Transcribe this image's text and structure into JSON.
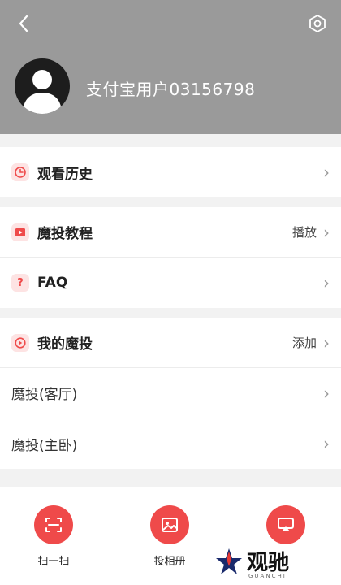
{
  "header": {
    "username": "支付宝用户03156798",
    "back_icon": "chevron-left-icon",
    "settings_icon": "settings-hex-icon"
  },
  "groups": {
    "history": {
      "label": "观看历史",
      "icon": "clock-icon"
    },
    "tutorial": {
      "label": "魔投教程",
      "value": "播放",
      "icon": "play-icon"
    },
    "faq": {
      "label": "FAQ",
      "icon": "question-icon"
    },
    "my_cast": {
      "label": "我的魔投",
      "value": "添加",
      "icon": "cast-circle-icon"
    },
    "device_living": {
      "label": "魔投(客厅)"
    },
    "device_bedroom": {
      "label": "魔投(主卧)"
    }
  },
  "bottom_actions": [
    {
      "label": "扫一扫",
      "icon": "scan-icon"
    },
    {
      "label": "投相册",
      "icon": "image-icon"
    },
    {
      "label": "",
      "icon": "screen-cast-icon"
    }
  ],
  "watermark": {
    "text": "观驰",
    "sub": "GUANCHI"
  },
  "colors": {
    "accent": "#ef4a4a",
    "header_bg": "#9a9a9a",
    "page_bg": "#f2f2f2"
  }
}
